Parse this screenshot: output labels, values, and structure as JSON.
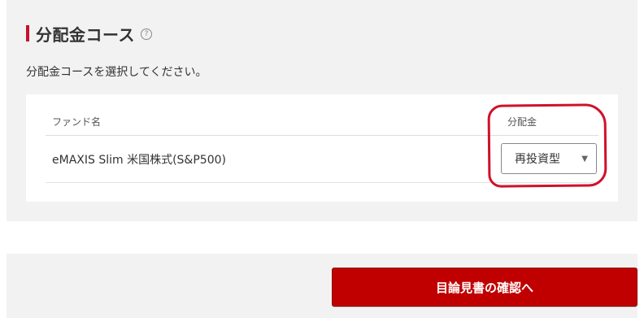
{
  "section": {
    "title": "分配金コース",
    "help_glyph": "?",
    "description": "分配金コースを選択してください。"
  },
  "table": {
    "headers": {
      "fund": "ファンド名",
      "distribution": "分配金"
    },
    "rows": [
      {
        "fund_name": "eMAXIS Slim 米国株式(S&P500)",
        "distribution_selected": "再投資型"
      }
    ]
  },
  "select_caret": "▼",
  "confirm_button": {
    "label": "目論見書の確認へ"
  },
  "colors": {
    "accent_red": "#c8102e",
    "button_red": "#c00000",
    "annotation_red": "#d0112b",
    "panel_bg": "#f2f2f2"
  }
}
